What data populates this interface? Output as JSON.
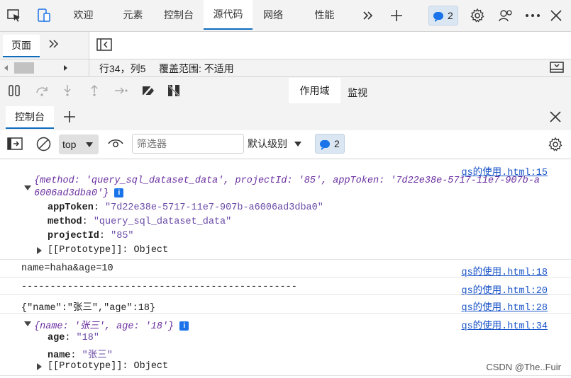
{
  "top_tabs": [
    "欢迎",
    "元素",
    "控制台",
    "源代码",
    "网络",
    "性能"
  ],
  "active_tab": "源代码",
  "issues_count": "2",
  "page_tab": "页面",
  "status": {
    "position": "行34，列5",
    "coverage": "覆盖范围: 不适用"
  },
  "right_tabs": {
    "scope": "作用域",
    "watch": "监视"
  },
  "drawer_tab": "控制台",
  "console": {
    "context": "top",
    "filter_placeholder": "筛选器",
    "level": "默认级别",
    "issues": "2"
  },
  "messages": {
    "m1": {
      "source": "qs的使用.html:15",
      "preview_a": "{method: 'query_sql_dataset_data', projectId: '85', appToken: '7d22e38e-5717-11e7-907b-a",
      "preview_b": "6006ad3dba0'}",
      "props": [
        {
          "key": "appToken",
          "value": "\"7d22e38e-5717-11e7-907b-a6006ad3dba0\""
        },
        {
          "key": "method",
          "value": "\"query_sql_dataset_data\""
        },
        {
          "key": "projectId",
          "value": "\"85\""
        }
      ],
      "proto": "[[Prototype]]: Object"
    },
    "m2": {
      "text": "name=haha&age=10",
      "source": "qs的使用.html:18"
    },
    "m3": {
      "text": "------------------------------------------------",
      "source": "qs的使用.html:20"
    },
    "m4": {
      "text": "{\"name\":\"张三\",\"age\":18}",
      "source": "qs的使用.html:28"
    },
    "m5": {
      "source": "qs的使用.html:34",
      "preview": "{name: '张三', age: '18'}",
      "props": [
        {
          "key": "age",
          "value": "\"18\""
        },
        {
          "key": "name",
          "value": "\"张三\""
        }
      ],
      "proto": "[[Prototype]]: Object"
    }
  },
  "watermark": "CSDN @The..Fuir"
}
